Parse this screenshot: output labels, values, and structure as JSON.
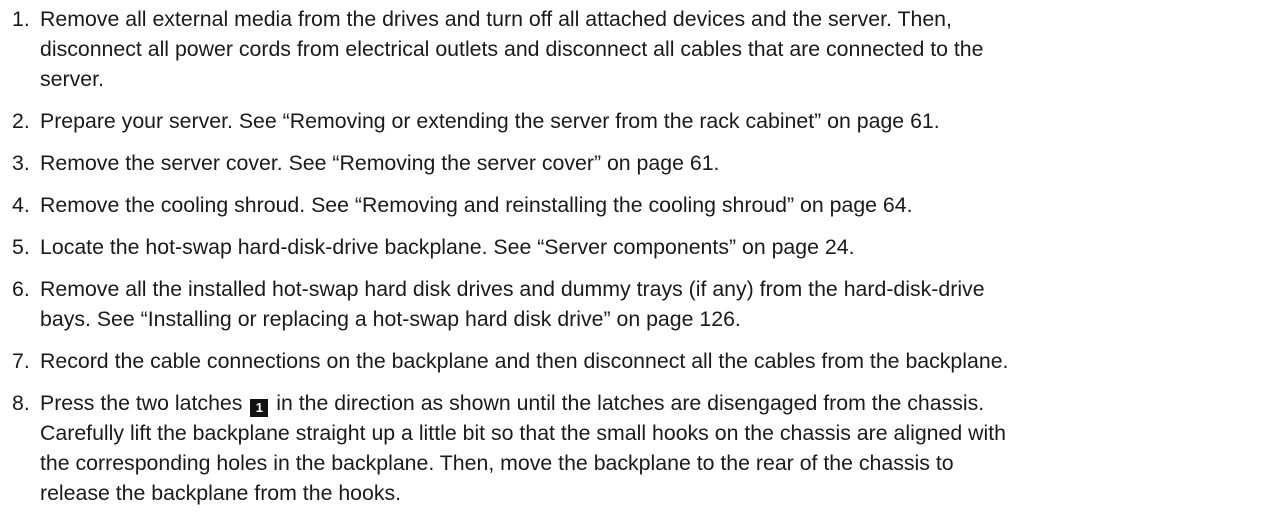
{
  "steps": [
    {
      "number": "1.",
      "lines": [
        "Remove all external media from the drives and turn off all attached devices and the server. Then,",
        "disconnect all power cords from electrical outlets and disconnect all cables that are connected to the",
        "server."
      ]
    },
    {
      "number": "2.",
      "lines": [
        "Prepare your server. See “Removing or extending the server from the rack cabinet” on page 61."
      ]
    },
    {
      "number": "3.",
      "lines": [
        "Remove the server cover. See “Removing the server cover” on page 61."
      ]
    },
    {
      "number": "4.",
      "lines": [
        "Remove the cooling shroud. See “Removing and reinstalling the cooling shroud” on page 64."
      ]
    },
    {
      "number": "5.",
      "lines": [
        "Locate the hot-swap hard-disk-drive backplane. See “Server components” on page 24."
      ]
    },
    {
      "number": "6.",
      "lines": [
        "Remove all the installed hot-swap hard disk drives and dummy trays (if any) from the hard-disk-drive",
        "bays. See “Installing or replacing a hot-swap hard disk drive” on page 126."
      ]
    },
    {
      "number": "7.",
      "lines": [
        "Record the cable connections on the backplane and then disconnect all the cables from the backplane."
      ]
    },
    {
      "number": "8.",
      "line1_before": "Press the two latches",
      "callout": "1",
      "line1_after": "in the direction as shown until the latches are disengaged from the chassis.",
      "lines": [
        "Carefully lift the backplane straight up a little bit so that the small hooks on the chassis are aligned with",
        "the corresponding holes in the backplane. Then, move the backplane to the rear of the chassis to",
        "release the backplane from the hooks."
      ]
    }
  ]
}
